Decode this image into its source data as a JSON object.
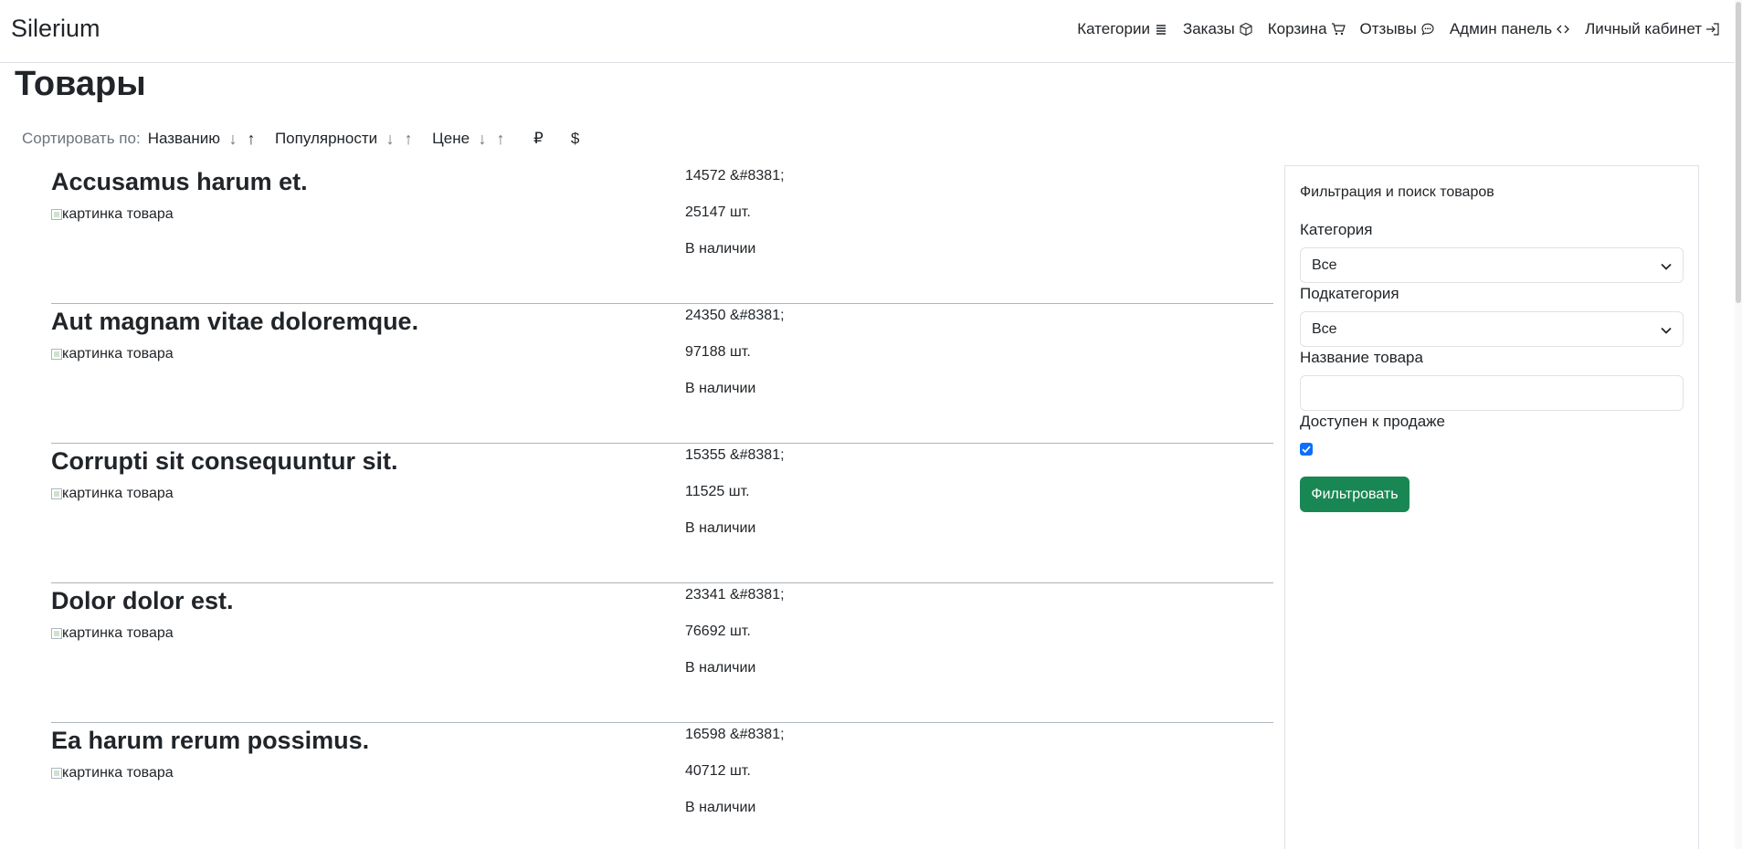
{
  "navbar": {
    "brand": "Silerium",
    "items": [
      {
        "label": "Категории",
        "icon": "list-icon"
      },
      {
        "label": "Заказы",
        "icon": "box-icon"
      },
      {
        "label": "Корзина",
        "icon": "cart-icon"
      },
      {
        "label": "Отзывы",
        "icon": "chat-icon"
      },
      {
        "label": "Админ панель",
        "icon": "code-icon"
      },
      {
        "label": "Личный кабинет",
        "icon": "login-icon"
      }
    ]
  },
  "page": {
    "title": "Товары"
  },
  "sort": {
    "label": "Сортировать по:",
    "groups": [
      {
        "name": "Названию",
        "down": "↓",
        "up": "↑"
      },
      {
        "name": "Популярности",
        "down": "↓",
        "up": "↑"
      },
      {
        "name": "Цене",
        "down": "↓",
        "up": "↑"
      }
    ],
    "currencies": [
      "₽",
      "$"
    ]
  },
  "products": [
    {
      "name": "Accusamus harum et.",
      "image_alt": "картинка товара",
      "price": "14572 &#8381;",
      "stock": "25147 шт.",
      "availability": "В наличии"
    },
    {
      "name": "Aut magnam vitae doloremque.",
      "image_alt": "картинка товара",
      "price": "24350 &#8381;",
      "stock": "97188 шт.",
      "availability": "В наличии"
    },
    {
      "name": "Corrupti sit consequuntur sit.",
      "image_alt": "картинка товара",
      "price": "15355 &#8381;",
      "stock": "11525 шт.",
      "availability": "В наличии"
    },
    {
      "name": "Dolor dolor est.",
      "image_alt": "картинка товара",
      "price": "23341 &#8381;",
      "stock": "76692 шт.",
      "availability": "В наличии"
    },
    {
      "name": "Ea harum rerum possimus.",
      "image_alt": "картинка товара",
      "price": "16598 &#8381;",
      "stock": "40712 шт.",
      "availability": "В наличии"
    }
  ],
  "filter": {
    "title": "Фильтрация и поиск товаров",
    "category_label": "Категория",
    "category_value": "Все",
    "subcategory_label": "Подкатегория",
    "subcategory_value": "Все",
    "name_label": "Название товара",
    "name_value": "",
    "available_label": "Доступен к продаже",
    "available_checked": true,
    "submit_label": "Фильтровать"
  },
  "colors": {
    "primary": "#0d6efd",
    "success": "#198754",
    "muted": "#6c757d",
    "border": "#dee2e6"
  }
}
